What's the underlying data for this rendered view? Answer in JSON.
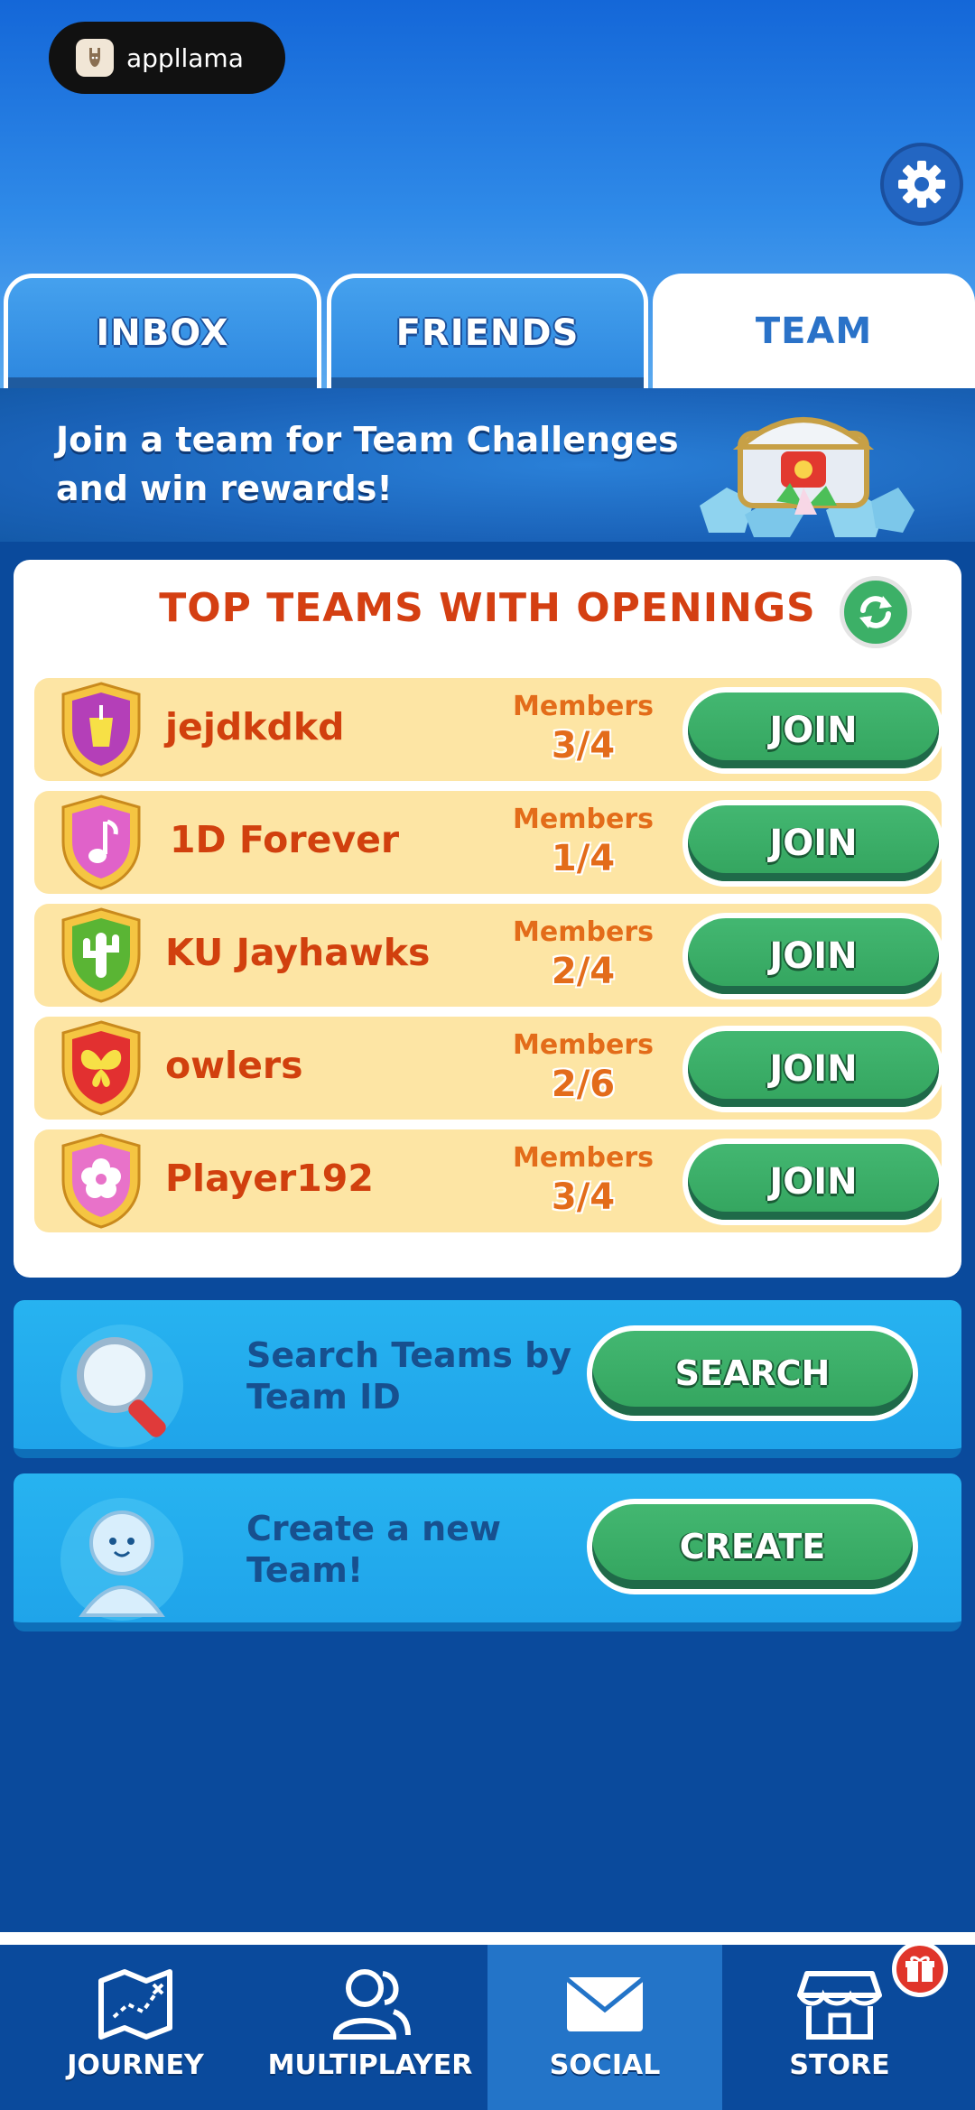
{
  "app_badge": {
    "label": "appllama"
  },
  "tabs": [
    {
      "label": "INBOX",
      "active": false
    },
    {
      "label": "FRIENDS",
      "active": false
    },
    {
      "label": "TEAM",
      "active": true
    }
  ],
  "banner": {
    "text": "Join a team for Team Challenges and win rewards!"
  },
  "top_teams": {
    "title": "TOP TEAMS WITH OPENINGS",
    "members_label": "Members",
    "join_label": "JOIN",
    "teams": [
      {
        "name": "jejdkdkd",
        "members": "3/4",
        "icon": "cup-icon",
        "color": "#b43fb8"
      },
      {
        "name": "1D Forever",
        "members": "1/4",
        "icon": "music-note-icon",
        "color": "#e062c9"
      },
      {
        "name": "KU Jayhawks",
        "members": "2/4",
        "icon": "cactus-icon",
        "color": "#5ab534"
      },
      {
        "name": "owlers",
        "members": "2/6",
        "icon": "butterfly-icon",
        "color": "#e23030"
      },
      {
        "name": "Player192",
        "members": "3/4",
        "icon": "flower-icon",
        "color": "#e872c9"
      }
    ]
  },
  "search_card": {
    "text": "Search Teams by Team ID",
    "button": "SEARCH"
  },
  "create_card": {
    "text": "Create a new Team!",
    "button": "CREATE"
  },
  "bottom_nav": [
    {
      "label": "JOURNEY",
      "icon": "map-icon",
      "active": false
    },
    {
      "label": "MULTIPLAYER",
      "icon": "users-icon",
      "active": false
    },
    {
      "label": "SOCIAL",
      "icon": "envelope-icon",
      "active": true
    },
    {
      "label": "STORE",
      "icon": "store-icon",
      "active": false
    }
  ],
  "colors": {
    "accent_green": "#3aad66",
    "title_red": "#d43f12",
    "row_bg": "#fde5a4",
    "nav_bg": "#0a4a9c"
  }
}
